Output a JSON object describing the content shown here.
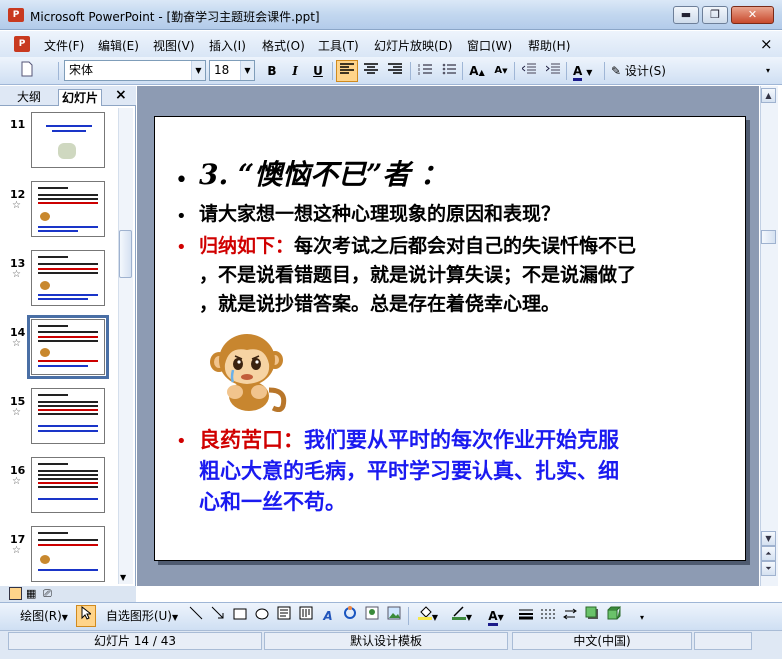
{
  "window": {
    "app_icon": "P",
    "title": "Microsoft PowerPoint - [勤奋学习主题班会课件.ppt]",
    "minimize": "▬",
    "restore": "❐",
    "close": "✕"
  },
  "menu": {
    "doc_icon": "P",
    "items": [
      "文件(F)",
      "编辑(E)",
      "视图(V)",
      "插入(I)",
      "格式(O)",
      "工具(T)",
      "幻灯片放映(D)",
      "窗口(W)",
      "帮助(H)"
    ],
    "close_doc": "×"
  },
  "toolbar": {
    "font_name": "宋体",
    "font_size": "18",
    "bold": "B",
    "italic": "I",
    "underline": "U",
    "design_label": "设计(S)",
    "font_color_label": "A"
  },
  "panel": {
    "tab_outline": "大纲",
    "tab_slides": "幻灯片",
    "close": "×"
  },
  "thumbnails": [
    {
      "num": "11",
      "star": ""
    },
    {
      "num": "12",
      "star": "☆"
    },
    {
      "num": "13",
      "star": "☆"
    },
    {
      "num": "14",
      "star": "☆"
    },
    {
      "num": "15",
      "star": "☆"
    },
    {
      "num": "16",
      "star": "☆"
    },
    {
      "num": "17",
      "star": "☆"
    }
  ],
  "selected_slide": 14,
  "slide": {
    "title": "3. “懊恼不已”者 ：",
    "question": "请大家想一想这种心理现象的原因和表现？",
    "summary_label": "归纳如下：",
    "summary_line1": "每次考试之后都会对自己的失误忏悔不已",
    "summary_line2": "，不是说看错题目，就是说计算失误；不是说漏做了",
    "summary_line3": "，就是说抄错答案。总是存在着侥幸心理。",
    "advice_label": "良药苦口：",
    "advice_line1": "我们要从平时的每次作业开始克服",
    "advice_line2": "粗心大意的毛病，平时学习要认真、扎实、细",
    "advice_line3": "心和一丝不苟。",
    "bullet": "•"
  },
  "drawbar": {
    "draw_label": "绘图(R)",
    "autoshapes_label": "自选图形(U)"
  },
  "status": {
    "slide_pos": "幻灯片 14 / 43",
    "template": "默认设计模板",
    "language": "中文(中国)"
  },
  "colors": {
    "red_text": "#d00000",
    "blue_text": "#1a1af0",
    "main_bg": "#8d9bb3"
  }
}
